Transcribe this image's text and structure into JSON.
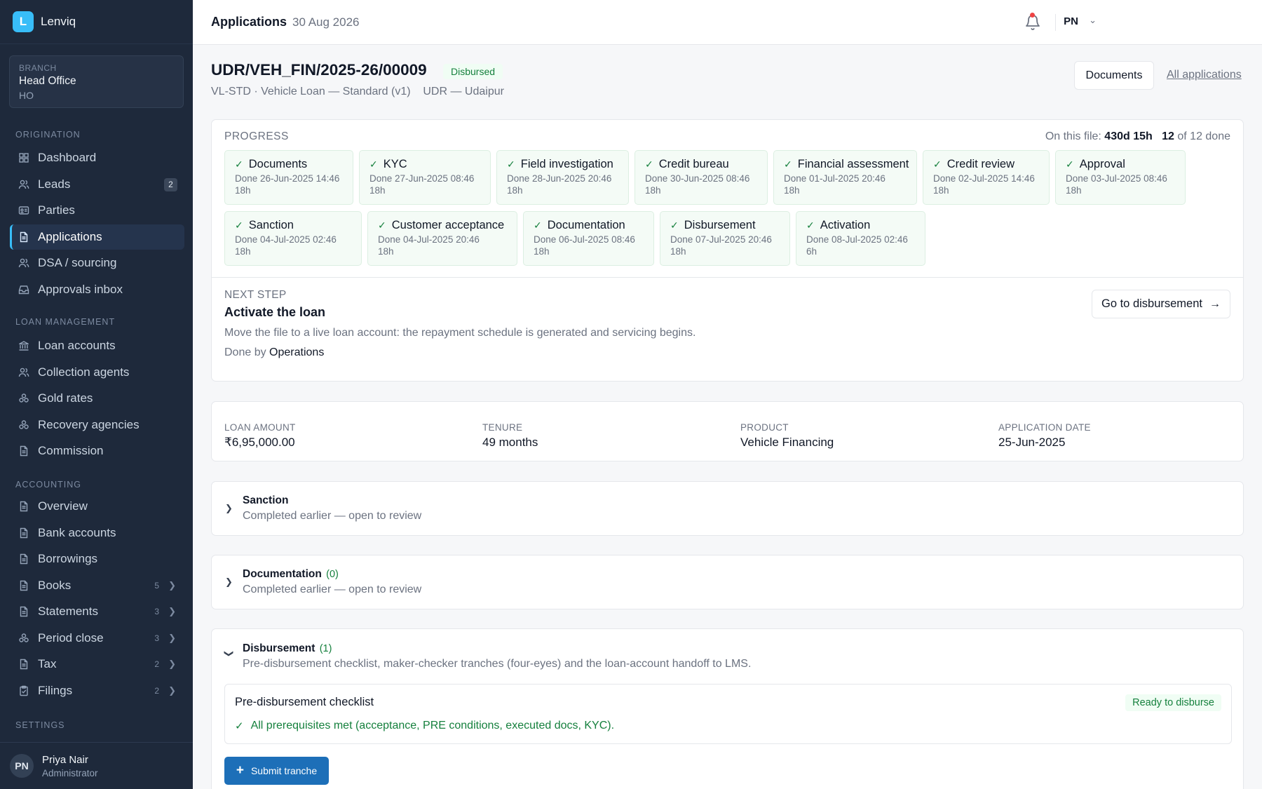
{
  "brand": {
    "logo_letter": "L",
    "name": "Lenviq"
  },
  "branch": {
    "label": "BRANCH",
    "name": "Head Office",
    "code": "HO"
  },
  "nav": {
    "origination_label": "ORIGINATION",
    "origination": [
      {
        "label": "Dashboard",
        "icon": "dashboard-icon"
      },
      {
        "label": "Leads",
        "icon": "users-icon",
        "badge": "2"
      },
      {
        "label": "Parties",
        "icon": "id-card-icon"
      },
      {
        "label": "Applications",
        "icon": "file-icon",
        "active": true
      },
      {
        "label": "DSA / sourcing",
        "icon": "users-icon"
      },
      {
        "label": "Approvals inbox",
        "icon": "inbox-icon"
      }
    ],
    "loan_label": "LOAN MANAGEMENT",
    "loan": [
      {
        "label": "Loan accounts",
        "icon": "bank-icon"
      },
      {
        "label": "Collection agents",
        "icon": "users-icon"
      },
      {
        "label": "Gold rates",
        "icon": "coins-icon"
      },
      {
        "label": "Recovery agencies",
        "icon": "coins-icon"
      },
      {
        "label": "Commission",
        "icon": "file-icon"
      }
    ],
    "accounting_label": "ACCOUNTING",
    "accounting": [
      {
        "label": "Overview",
        "icon": "file-icon"
      },
      {
        "label": "Bank accounts",
        "icon": "file-icon"
      },
      {
        "label": "Borrowings",
        "icon": "file-icon"
      },
      {
        "label": "Books",
        "icon": "file-icon",
        "count": "5"
      },
      {
        "label": "Statements",
        "icon": "file-icon",
        "count": "3"
      },
      {
        "label": "Period close",
        "icon": "coins-icon",
        "count": "3"
      },
      {
        "label": "Tax",
        "icon": "file-icon",
        "count": "2"
      },
      {
        "label": "Filings",
        "icon": "clipboard-icon",
        "count": "2"
      }
    ],
    "settings_label": "SETTINGS"
  },
  "user": {
    "initials": "PN",
    "name": "Priya Nair",
    "role": "Administrator"
  },
  "topbar": {
    "title": "Applications",
    "date": "30 Aug 2026",
    "user_initials": "PN"
  },
  "header": {
    "app_id": "UDR/VEH_FIN/2025-26/00009",
    "status": "Disbursed",
    "subtitle": "VL-STD · Vehicle Loan — Standard (v1)    UDR — Udaipur",
    "documents_button": "Documents",
    "all_link": "All applications"
  },
  "progress": {
    "label": "PROGRESS",
    "meta_prefix": "On this file:",
    "meta_duration": "430d 15h",
    "meta_done_count": "12",
    "meta_done_suffix": "of 12 done",
    "stages": [
      {
        "title": "Documents",
        "done": "Done 26-Jun-2025 14:46",
        "dur": "18h"
      },
      {
        "title": "KYC",
        "done": "Done 27-Jun-2025 08:46",
        "dur": "18h"
      },
      {
        "title": "Field investigation",
        "done": "Done 28-Jun-2025 20:46",
        "dur": "18h"
      },
      {
        "title": "Credit bureau",
        "done": "Done 30-Jun-2025 08:46",
        "dur": "18h"
      },
      {
        "title": "Financial assessment",
        "done": "Done 01-Jul-2025 20:46",
        "dur": "18h"
      },
      {
        "title": "Credit review",
        "done": "Done 02-Jul-2025 14:46",
        "dur": "18h"
      },
      {
        "title": "Approval",
        "done": "Done 03-Jul-2025 08:46",
        "dur": "18h"
      },
      {
        "title": "Sanction",
        "done": "Done 04-Jul-2025 02:46",
        "dur": "18h"
      },
      {
        "title": "Customer acceptance",
        "done": "Done 04-Jul-2025 20:46",
        "dur": "18h"
      },
      {
        "title": "Documentation",
        "done": "Done 06-Jul-2025 08:46",
        "dur": "18h"
      },
      {
        "title": "Disbursement",
        "done": "Done 07-Jul-2025 20:46",
        "dur": "18h"
      },
      {
        "title": "Activation",
        "done": "Done 08-Jul-2025 02:46",
        "dur": "6h"
      }
    ]
  },
  "next_step": {
    "label": "NEXT STEP",
    "title": "Activate the loan",
    "description": "Move the file to a live loan account: the repayment schedule is generated and servicing begins.",
    "done_by_prefix": "Done by",
    "done_by": "Operations",
    "button": "Go to disbursement"
  },
  "summary": [
    {
      "label": "LOAN AMOUNT",
      "value": "₹6,95,000.00"
    },
    {
      "label": "TENURE",
      "value": "49 months"
    },
    {
      "label": "PRODUCT",
      "value": "Vehicle Financing"
    },
    {
      "label": "APPLICATION DATE",
      "value": "25-Jun-2025"
    }
  ],
  "sections": {
    "sanction": {
      "title": "Sanction",
      "subtitle": "Completed earlier — open to review"
    },
    "documentation": {
      "title": "Documentation",
      "count": "(0)",
      "subtitle": "Completed earlier — open to review"
    },
    "disbursement": {
      "title": "Disbursement",
      "count": "(1)",
      "subtitle": "Pre-disbursement checklist, maker-checker tranches (four-eyes) and the loan-account handoff to LMS.",
      "checklist_title": "Pre-disbursement checklist",
      "checklist_badge": "Ready to disburse",
      "checklist_line": "All prerequisites met (acceptance, PRE conditions, executed docs, KYC).",
      "submit_button": "Submit tranche"
    }
  }
}
